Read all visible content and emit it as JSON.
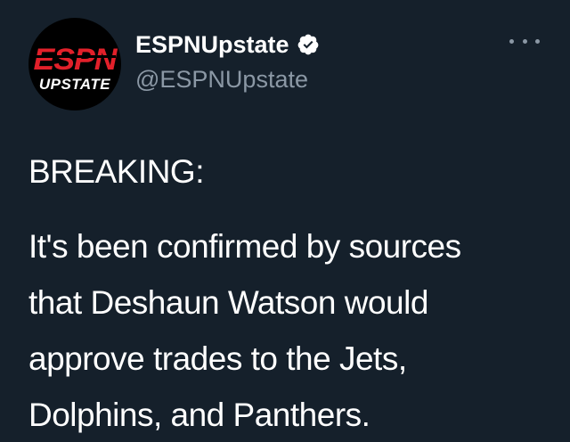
{
  "account": {
    "avatar_top_text": "ESPN",
    "avatar_bottom_text": "UPSTATE",
    "display_name": "ESPNUpstate",
    "handle": "@ESPNUpstate",
    "verified": true
  },
  "tweet": {
    "heading": "BREAKING:",
    "lines": [
      "It's been confirmed by sources",
      "that Deshaun Watson would",
      "approve trades to the Jets,",
      "Dolphins, and Panthers."
    ]
  },
  "colors": {
    "background": "#15202b",
    "text": "#ffffff",
    "secondary_text": "#8b98a5",
    "espn_red": "#e2202a",
    "verified_badge": "#ffffff"
  },
  "icons": {
    "verified": "verified-badge-icon",
    "more": "more-options-icon"
  }
}
